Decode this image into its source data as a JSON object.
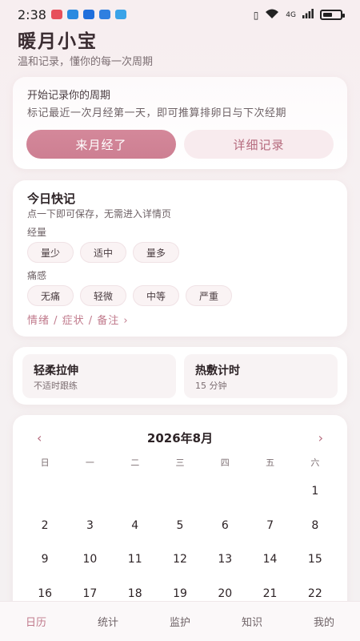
{
  "status_bar": {
    "time": "2:38",
    "notifications": [
      {
        "name": "mail-notification-icon",
        "color": "#e74f5b"
      },
      {
        "name": "send-notification-icon",
        "color": "#2a8ae0"
      },
      {
        "name": "app-notification-icon",
        "color": "#1f6fdc"
      },
      {
        "name": "chat-notification-icon",
        "color": "#2f7fe0"
      },
      {
        "name": "browser-notification-icon",
        "color": "#3aa3e8"
      }
    ],
    "network": "4G",
    "battery_level": 0.55
  },
  "app": {
    "title": "暖月小宝",
    "subtitle": "温和记录，懂你的每一次周期"
  },
  "start_card": {
    "title": "开始记录你的周期",
    "description": "标记最近一次月经第一天，即可推算排卵日与下次经期",
    "primary_button": "来月经了",
    "secondary_button": "详细记录"
  },
  "quick_note": {
    "title": "今日快记",
    "hint": "点一下即可保存，无需进入详情页",
    "flow_label": "经量",
    "flow_options": [
      "量少",
      "适中",
      "量多"
    ],
    "pain_label": "痛感",
    "pain_options": [
      "无痛",
      "轻微",
      "中等",
      "严重"
    ],
    "more_link": "情绪 / 症状 / 备注 ›"
  },
  "tools": [
    {
      "name": "轻柔拉伸",
      "desc": "不适时跟练"
    },
    {
      "name": "热敷计时",
      "desc": "15 分钟"
    }
  ],
  "calendar": {
    "prev": "‹",
    "next": "›",
    "month_label": "2026年8月",
    "weekdays": [
      "日",
      "一",
      "二",
      "三",
      "四",
      "五",
      "六"
    ],
    "leading_blanks": 6,
    "days": [
      "1",
      "2",
      "3",
      "4",
      "5",
      "6",
      "7",
      "8",
      "9",
      "10",
      "11",
      "12",
      "13",
      "14",
      "15",
      "16",
      "17",
      "18",
      "19",
      "20",
      "21",
      "22"
    ]
  },
  "nav": {
    "items": [
      "日历",
      "统计",
      "监护",
      "知识",
      "我的"
    ],
    "active_index": 0
  },
  "colors": {
    "accent": "#cd7f92",
    "accent_text": "#c07a8c"
  }
}
